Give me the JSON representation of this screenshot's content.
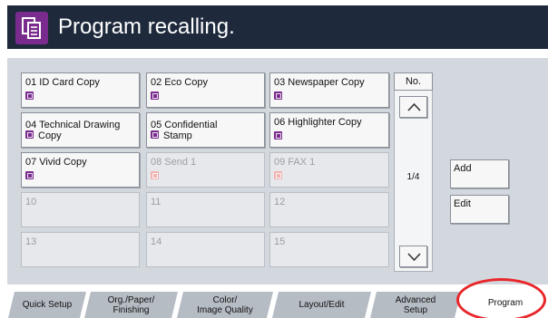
{
  "header": {
    "title": "Program recalling.",
    "icon": "program-copy-icon",
    "background_color": "#1e2a3c",
    "icon_color": "#7a2c8e"
  },
  "programs": [
    {
      "number": "01",
      "name": "ID Card Copy",
      "registered": true
    },
    {
      "number": "02",
      "name": "Eco Copy",
      "registered": true
    },
    {
      "number": "03",
      "name": "Newspaper Copy",
      "registered": true
    },
    {
      "number": "04",
      "name": "Technical Drawing Copy",
      "registered": true
    },
    {
      "number": "05",
      "name": "Confidential Stamp",
      "registered": true
    },
    {
      "number": "06",
      "name": "Highlighter Copy",
      "registered": true
    },
    {
      "number": "07",
      "name": "Vivid Copy",
      "registered": true
    },
    {
      "number": "08",
      "name": "Send 1",
      "registered": false
    },
    {
      "number": "09",
      "name": "FAX 1",
      "registered": false
    },
    {
      "number": "10",
      "name": "",
      "registered": false
    },
    {
      "number": "11",
      "name": "",
      "registered": false
    },
    {
      "number": "12",
      "name": "",
      "registered": false
    },
    {
      "number": "13",
      "name": "",
      "registered": false
    },
    {
      "number": "14",
      "name": "",
      "registered": false
    },
    {
      "number": "15",
      "name": "",
      "registered": false
    }
  ],
  "cell_text": {
    "p01": "01  ID Card Copy",
    "p02": "02  Eco Copy",
    "p03": "03  Newspaper Copy",
    "p04_line1": "04  Technical Drawing",
    "p04_line2": "Copy",
    "p05_line1": "05  Confidential",
    "p05_line2": "Stamp",
    "p06": "06  Highlighter Copy",
    "p07": "07  Vivid Copy",
    "p08": "08  Send 1",
    "p09": "09  FAX 1",
    "p10": "10",
    "p11": "11",
    "p12": "12",
    "p13": "13",
    "p14": "14",
    "p15": "15"
  },
  "navigation": {
    "number_button": "No.",
    "page_indicator": "1/4",
    "up_icon": "chevron-up-icon",
    "down_icon": "chevron-down-icon"
  },
  "actions": {
    "add": "Add",
    "edit": "Edit"
  },
  "tabs": [
    {
      "id": "quick-setup",
      "line1": "Quick Setup",
      "line2": ""
    },
    {
      "id": "org-paper-finishing",
      "line1": "Org./Paper/",
      "line2": "Finishing"
    },
    {
      "id": "color-image-quality",
      "line1": "Color/",
      "line2": "Image Quality"
    },
    {
      "id": "layout-edit",
      "line1": "Layout/Edit",
      "line2": ""
    },
    {
      "id": "advanced-setup",
      "line1": "Advanced",
      "line2": "Setup"
    },
    {
      "id": "program",
      "line1": "Program",
      "line2": "",
      "selected": true
    }
  ],
  "highlight": {
    "target": "program",
    "color": "#e8262a"
  }
}
